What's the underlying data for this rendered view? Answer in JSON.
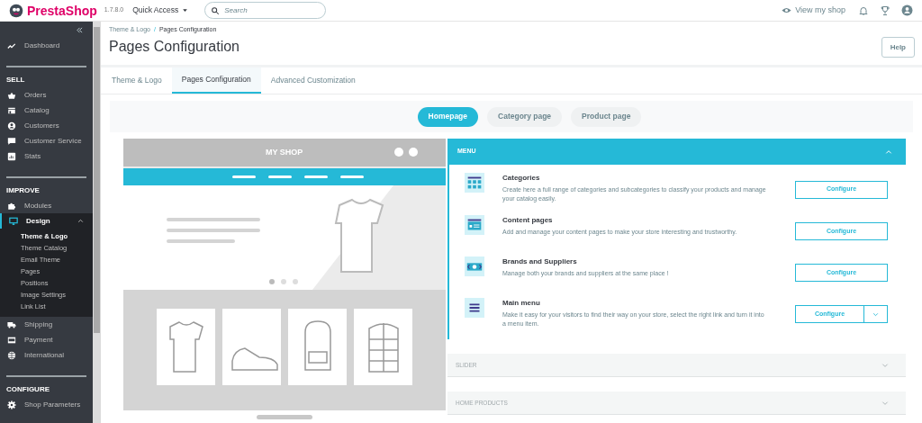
{
  "header": {
    "brand": "PrestaShop",
    "version": "1.7.8.0",
    "quick_access": "Quick Access",
    "search": {
      "placeholder": "Search"
    },
    "view_shop": "View my shop"
  },
  "sidebar": {
    "sections": [
      {
        "items": [
          {
            "label": "Dashboard",
            "selected": false
          }
        ]
      },
      {
        "title": "SELL",
        "items": [
          {
            "label": "Orders",
            "selected": false
          },
          {
            "label": "Catalog",
            "selected": false
          },
          {
            "label": "Customers",
            "selected": false
          },
          {
            "label": "Customer Service",
            "selected": false
          },
          {
            "label": "Stats",
            "selected": false
          }
        ]
      },
      {
        "title": "IMPROVE",
        "items": [
          {
            "label": "Modules",
            "selected": false
          },
          {
            "label": "Design",
            "selected": true,
            "expanded": true,
            "children": [
              {
                "label": "Theme & Logo",
                "selected": true
              },
              {
                "label": "Theme Catalog",
                "selected": false
              },
              {
                "label": "Email Theme",
                "selected": false
              },
              {
                "label": "Pages",
                "selected": false
              },
              {
                "label": "Positions",
                "selected": false
              },
              {
                "label": "Image Settings",
                "selected": false
              },
              {
                "label": "Link List",
                "selected": false
              }
            ]
          },
          {
            "label": "Shipping",
            "selected": false
          },
          {
            "label": "Payment",
            "selected": false
          },
          {
            "label": "International",
            "selected": false
          }
        ]
      },
      {
        "title": "CONFIGURE",
        "items": [
          {
            "label": "Shop Parameters",
            "selected": false
          }
        ]
      }
    ]
  },
  "breadcrumb": [
    "Theme & Logo",
    "Pages Configuration"
  ],
  "breadcrumb_separator": "/",
  "page_title": "Pages Configuration",
  "help_button": "Help",
  "tabs": [
    {
      "label": "Theme & Logo",
      "selected": false
    },
    {
      "label": "Pages Configuration",
      "selected": true
    },
    {
      "label": "Advanced Customization",
      "selected": false
    }
  ],
  "page_types": [
    {
      "label": "Homepage",
      "selected": true
    },
    {
      "label": "Category page",
      "selected": false
    },
    {
      "label": "Product page",
      "selected": false
    }
  ],
  "preview": {
    "shop_name": "MY SHOP"
  },
  "panels": [
    {
      "title": "MENU",
      "expanded": true,
      "items": [
        {
          "name": "Categories",
          "description": "Create here a full range of categories and subcategories to classify your products and manage your catalog easily.",
          "button": "Configure",
          "dropdown": false
        },
        {
          "name": "Content pages",
          "description": "Add and manage your content pages to make your store interesting and trustworthy.",
          "button": "Configure",
          "dropdown": false
        },
        {
          "name": "Brands and Suppliers",
          "description": "Manage both your brands and suppliers at the same place !",
          "button": "Configure",
          "dropdown": false
        },
        {
          "name": "Main menu",
          "description": "Make it easy for your visitors to find their way on your store, select the right link and turn it into a menu item.",
          "button": "Configure",
          "dropdown": true
        }
      ]
    },
    {
      "title": "SLIDER",
      "expanded": false
    },
    {
      "title": "HOME PRODUCTS",
      "expanded": false
    }
  ]
}
